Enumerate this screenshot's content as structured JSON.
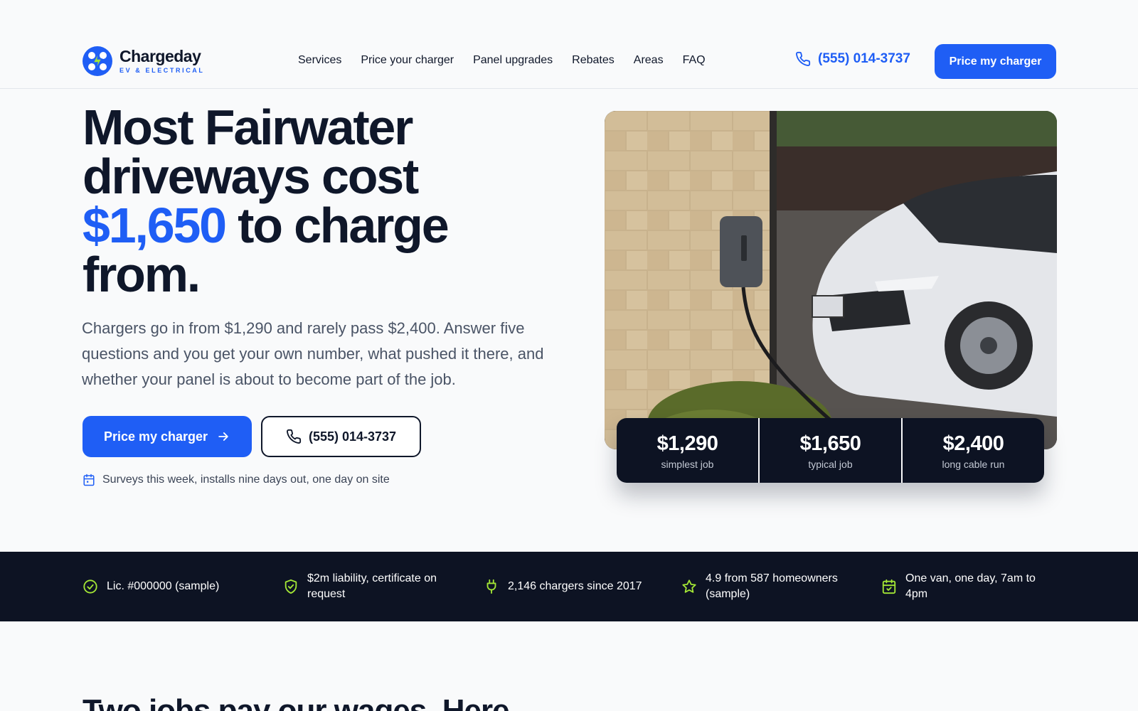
{
  "brand": {
    "name": "Chargeday",
    "sub": "EV & ELECTRICAL",
    "color": "#1f5ef5",
    "accent": "#a3e635"
  },
  "nav": {
    "items": [
      "Services",
      "Price your charger",
      "Panel upgrades",
      "Rebates",
      "Areas",
      "FAQ"
    ]
  },
  "header": {
    "phone": "(555) 014-3737",
    "cta": "Price my charger"
  },
  "hero": {
    "title_line1": "Most Fairwater",
    "title_line2": "driveways cost",
    "title_accent": "$1,650",
    "title_line3_rest": " to charge",
    "title_line4": "from.",
    "lead": "Chargers go in from $1,290 and rarely pass $2,400. Answer five questions and you get your own number, what pushed it there, and whether your panel is about to become part of the job.",
    "primary_cta": "Price my charger",
    "secondary_cta": "(555) 014-3737",
    "note": "Surveys this week, installs nine days out, one day on site"
  },
  "prices": [
    {
      "value": "$1,290",
      "label": "simplest job"
    },
    {
      "value": "$1,650",
      "label": "typical job"
    },
    {
      "value": "$2,400",
      "label": "long cable run"
    }
  ],
  "trust": [
    {
      "icon": "check-circle-icon",
      "text": "Lic. #000000 (sample)"
    },
    {
      "icon": "shield-check-icon",
      "text": "$2m liability, certificate on request"
    },
    {
      "icon": "plug-icon",
      "text": "2,146 chargers since 2017"
    },
    {
      "icon": "star-icon",
      "text": "4.9 from 587 homeowners (sample)"
    },
    {
      "icon": "calendar-check-icon",
      "text": "One van, one day, 7am to 4pm"
    }
  ],
  "section": {
    "title": "Two jobs pay our wages. Here"
  }
}
